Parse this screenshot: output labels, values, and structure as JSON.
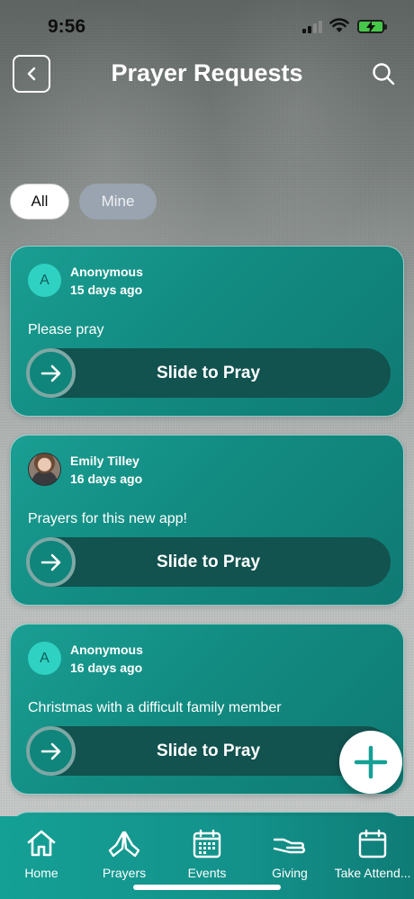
{
  "status_bar": {
    "time": "9:56"
  },
  "header": {
    "title": "Prayer Requests",
    "back_icon": "chevron-left-icon",
    "search_icon": "search-icon"
  },
  "filters": [
    {
      "label": "All",
      "selected": true
    },
    {
      "label": "Mine",
      "selected": false
    }
  ],
  "requests": [
    {
      "avatar_letter": "A",
      "author": "Anonymous",
      "ago": "15 days ago",
      "text": "Please pray",
      "action": "Slide to Pray"
    },
    {
      "avatar_letter": "",
      "author": "Emily Tilley",
      "ago": "16 days ago",
      "text": "Prayers for this new app!",
      "action": "Slide to Pray"
    },
    {
      "avatar_letter": "A",
      "author": "Anonymous",
      "ago": "16 days ago",
      "text": "Christmas with a difficult family member",
      "action": "Slide to Pray"
    }
  ],
  "tabs": [
    {
      "label": "Home",
      "icon": "home-icon"
    },
    {
      "label": "Prayers",
      "icon": "praying-hands-icon"
    },
    {
      "label": "Events",
      "icon": "calendar-grid-icon"
    },
    {
      "label": "Giving",
      "icon": "giving-hand-icon"
    },
    {
      "label": "Take Attend...",
      "icon": "calendar-icon"
    }
  ],
  "colors": {
    "accent": "#13918a",
    "slider": "#12524f",
    "fab_plus": "#14a095"
  }
}
